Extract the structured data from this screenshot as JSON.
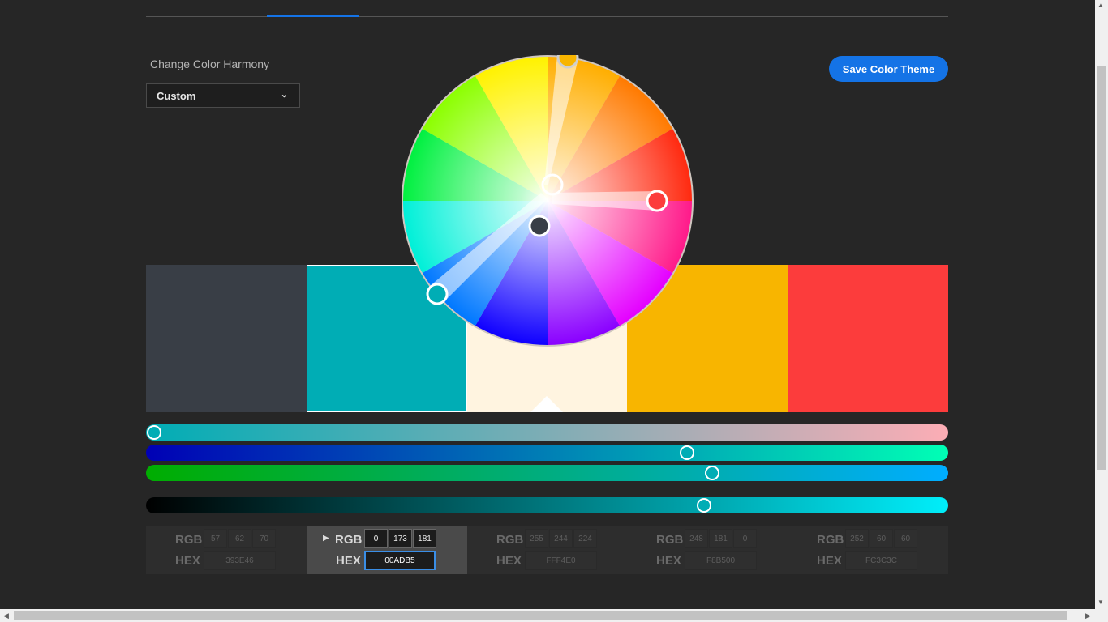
{
  "header": {
    "active_tab_index": 1
  },
  "harmony": {
    "label": "Change Color Harmony",
    "selected": "Custom"
  },
  "toolbar": {
    "save_label": "Save Color Theme"
  },
  "theme": {
    "selected_index": 1,
    "base_index": 2,
    "swatches": [
      {
        "rgb": [
          "57",
          "62",
          "70"
        ],
        "hex": "393E46",
        "color": "#393E46"
      },
      {
        "rgb": [
          "0",
          "173",
          "181"
        ],
        "hex": "00ADB5",
        "color": "#00ADB5"
      },
      {
        "rgb": [
          "255",
          "244",
          "224"
        ],
        "hex": "FFF4E0",
        "color": "#FFF4E0"
      },
      {
        "rgb": [
          "248",
          "181",
          "0"
        ],
        "hex": "F8B500",
        "color": "#F8B500"
      },
      {
        "rgb": [
          "252",
          "60",
          "60"
        ],
        "hex": "FC3C3C",
        "color": "#FC3C3C"
      }
    ]
  },
  "sliders": {
    "red": {
      "value": 0
    },
    "green": {
      "value": 173
    },
    "blue": {
      "value": 181
    },
    "brightness": {
      "value": 0.7
    }
  },
  "labels": {
    "rgb": "RGB",
    "hex": "HEX"
  }
}
